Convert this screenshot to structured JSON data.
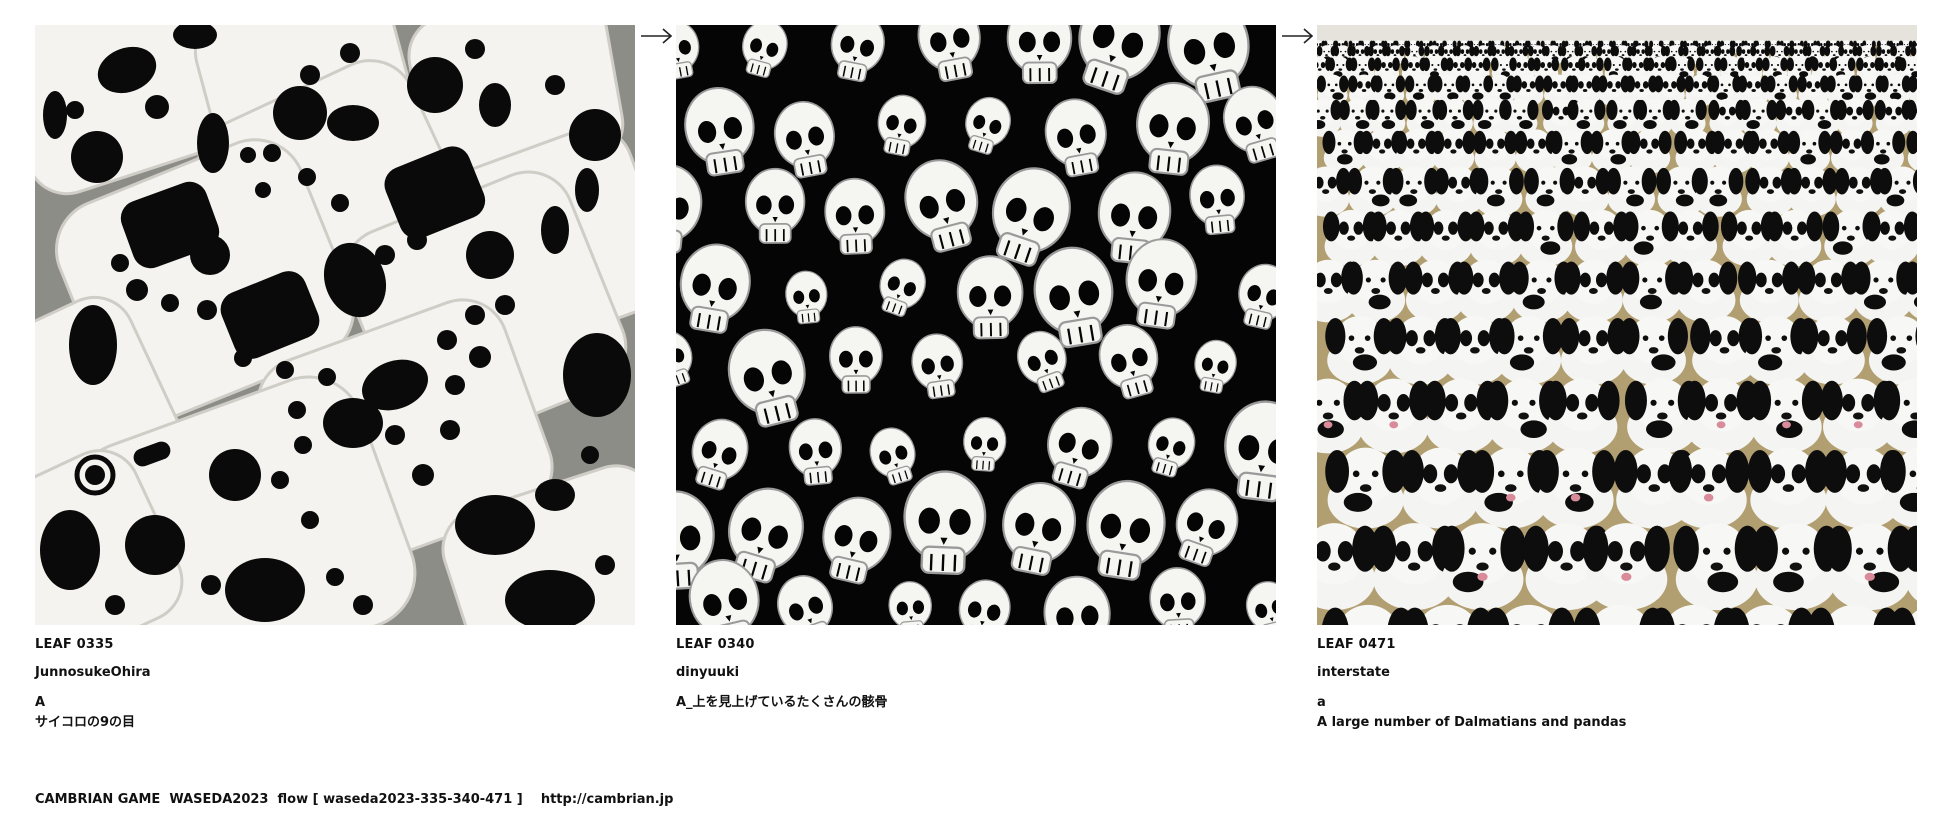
{
  "leaves": [
    {
      "id": "LEAF 0335",
      "author": "JunnosukeOhira",
      "desc": "A\nサイコロの9の目",
      "image": "white-dice-with-black-pips"
    },
    {
      "id": "LEAF 0340",
      "author": "dinyuuki",
      "desc": "A_上を見上げているたくさんの骸骨",
      "image": "many-white-skulls-on-black"
    },
    {
      "id": "LEAF 0471",
      "author": "interstate",
      "desc": "a\nA large number of Dalmatians and pandas",
      "image": "crowd-of-black-white-puppies"
    }
  ],
  "arrows": [
    "arrow-right-icon",
    "arrow-right-icon"
  ],
  "footer": {
    "text": "CAMBRIAN GAME  WASEDA2023  flow [ waseda2023-335-340-471 ]    http://cambrian.jp"
  },
  "colors": {
    "background": "#ffffff",
    "text": "#111111",
    "dice": "#f4f3ef",
    "pip": "#0a0a0a",
    "skull_bg": "#050505",
    "floor": "#b29f71"
  }
}
